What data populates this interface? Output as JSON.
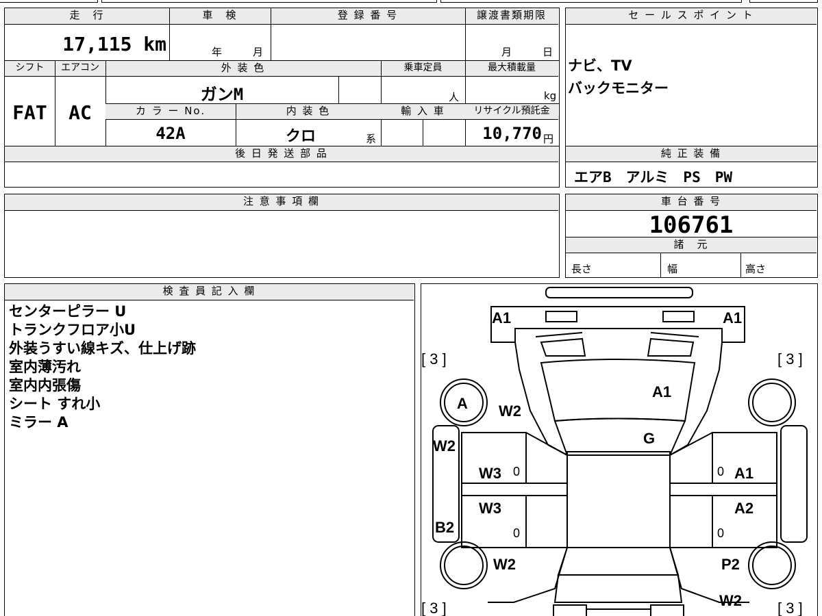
{
  "top_header": {
    "odometer": "走　行",
    "inspection": "車　検",
    "registration": "登 録 番 号",
    "transfer_deadline": "譲渡書類期限"
  },
  "odometer_value": "17,115 km",
  "inspection_year": "年",
  "inspection_month": "月",
  "transfer_month": "月",
  "transfer_day": "日",
  "row2_header": {
    "shift": "シフト",
    "aircon": "エアコン",
    "exterior": "外 装 色",
    "capacity": "乗車定員",
    "max_load": "最大積載量"
  },
  "shift_value": "FAT",
  "aircon_value": "AC",
  "exterior_color": "ガンM",
  "capacity_unit": "人",
  "load_unit": "kg",
  "row3_header": {
    "color_no": "カ ラ ー No.",
    "interior": "内 装 色",
    "import": "輸 入 車",
    "recycle": "リサイクル預託金"
  },
  "color_no_value": "42A",
  "interior_value": "クロ",
  "interior_suffix": "系",
  "recycle_value": "10,770",
  "recycle_unit": "円",
  "later_parts_header": "後 日 発 送 部 品",
  "sales_header": "セ ー ル ス ポ イ ン ト",
  "sales_points": [
    "ナビ、TV",
    "バックモニター"
  ],
  "genuine_header": "純 正 装 備",
  "genuine_equipment": "エアB　アルミ　PS　PW",
  "caution_header": "注 意 事 項 欄",
  "chassis_header": "車 台 番 号",
  "chassis_number": "106761",
  "specs_header": "諸　元",
  "specs": {
    "length": "長さ",
    "width": "幅",
    "height": "高さ"
  },
  "inspector_header": "検 査 員 記 入 欄",
  "inspector_notes": [
    "センターピラー U",
    "トランクフロア小U",
    "外装うすい線キズ、仕上げ跡",
    "室内薄汚れ",
    "室内内張傷",
    "シート すれ小",
    "ミラー A"
  ],
  "diagram": {
    "labels": {
      "a1_top_left": "A1",
      "a1_top_right": "A1",
      "tread_fl": "[ 3 ]",
      "tread_fr": "[ 3 ]",
      "tread_rl": "[ 3 ]",
      "tread_rr": "[ 3 ]",
      "wheel_fl": "A",
      "fender_fl": "W2",
      "hood": "A1",
      "windshield": "G",
      "fender_l_side": "W2",
      "door_fl": "W3",
      "door_fr": "A1",
      "door_rl": "W3",
      "door_rr": "A2",
      "rocker_l": "B2",
      "quarter_rl": "W2",
      "quarter_rr": "P2",
      "rear_r": "W2",
      "zero_fl": "0",
      "zero_fr": "0",
      "zero_rl": "0",
      "zero_rr": "0"
    }
  }
}
